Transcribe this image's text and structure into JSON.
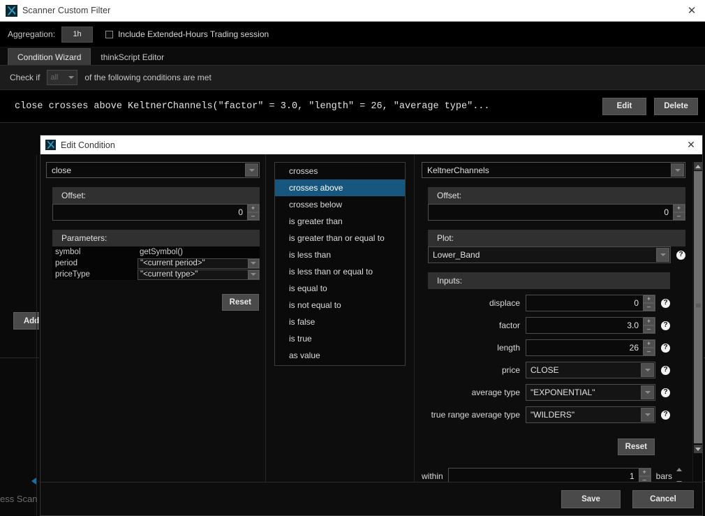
{
  "window": {
    "title": "Scanner Custom Filter",
    "logo_icon": "tos-logo-icon",
    "close_icon": "close-icon",
    "close_glyph": "✕"
  },
  "aggregation": {
    "label": "Aggregation:",
    "value": "1h",
    "extended_hours_label": "Include Extended-Hours Trading session",
    "extended_hours_checked": false
  },
  "tabs": [
    {
      "label": "Condition Wizard",
      "active": true
    },
    {
      "label": "thinkScript Editor",
      "active": false
    }
  ],
  "check_if": {
    "prefix": "Check if",
    "selected": "all",
    "suffix": "of the following conditions are met"
  },
  "condition": {
    "text": "close crosses above KeltnerChannels(\"factor\" = 3.0, \"length\" = 26, \"average type\"...",
    "edit_label": "Edit",
    "delete_label": "Delete"
  },
  "background": {
    "add_label": "Add",
    "status_text": "ess Scan"
  },
  "dialog": {
    "title": "Edit Condition",
    "logo_icon": "tos-logo-icon",
    "close_icon": "close-icon",
    "close_glyph": "✕",
    "left": {
      "source_value": "close",
      "offset_header": "Offset:",
      "offset_value": "0",
      "parameters_header": "Parameters:",
      "parameters": [
        {
          "name": "symbol",
          "value": "getSymbol()",
          "type": "plain"
        },
        {
          "name": "period",
          "value": "\"<current period>\"",
          "type": "combo"
        },
        {
          "name": "priceType",
          "value": "\"<current type>\"",
          "type": "combo"
        }
      ],
      "reset_label": "Reset"
    },
    "conditions": [
      {
        "label": "crosses",
        "selected": false
      },
      {
        "label": "crosses above",
        "selected": true
      },
      {
        "label": "crosses below",
        "selected": false
      },
      {
        "label": "is greater than",
        "selected": false
      },
      {
        "label": "is greater than or equal to",
        "selected": false
      },
      {
        "label": "is less than",
        "selected": false
      },
      {
        "label": "is less than or equal to",
        "selected": false
      },
      {
        "label": "is equal to",
        "selected": false
      },
      {
        "label": "is not equal to",
        "selected": false
      },
      {
        "label": "is false",
        "selected": false
      },
      {
        "label": "is true",
        "selected": false
      },
      {
        "label": "as value",
        "selected": false
      }
    ],
    "right": {
      "study_value": "KeltnerChannels",
      "offset_header": "Offset:",
      "offset_value": "0",
      "plot_header": "Plot:",
      "plot_value": "Lower_Band",
      "inputs_header": "Inputs:",
      "inputs": [
        {
          "label": "displace",
          "value": "0",
          "type": "spinner"
        },
        {
          "label": "factor",
          "value": "3.0",
          "type": "spinner"
        },
        {
          "label": "length",
          "value": "26",
          "type": "spinner"
        },
        {
          "label": "price",
          "value": "CLOSE",
          "type": "select"
        },
        {
          "label": "average type",
          "value": "\"EXPONENTIAL\"",
          "type": "select"
        },
        {
          "label": "true range average type",
          "value": "\"WILDERS\"",
          "type": "select"
        }
      ],
      "reset_label": "Reset",
      "within_label": "within",
      "within_value": "1",
      "within_units": "bars",
      "help_icon": "help-icon",
      "help_glyph": "?"
    },
    "footer": {
      "save_label": "Save",
      "cancel_label": "Cancel"
    }
  },
  "colors": {
    "accent_selected": "#17567f",
    "titlebar_bg": "#ffffff",
    "panel_bg": "#0d0d0d",
    "section_header": "#303030",
    "button_face": "#4a4a4a"
  }
}
